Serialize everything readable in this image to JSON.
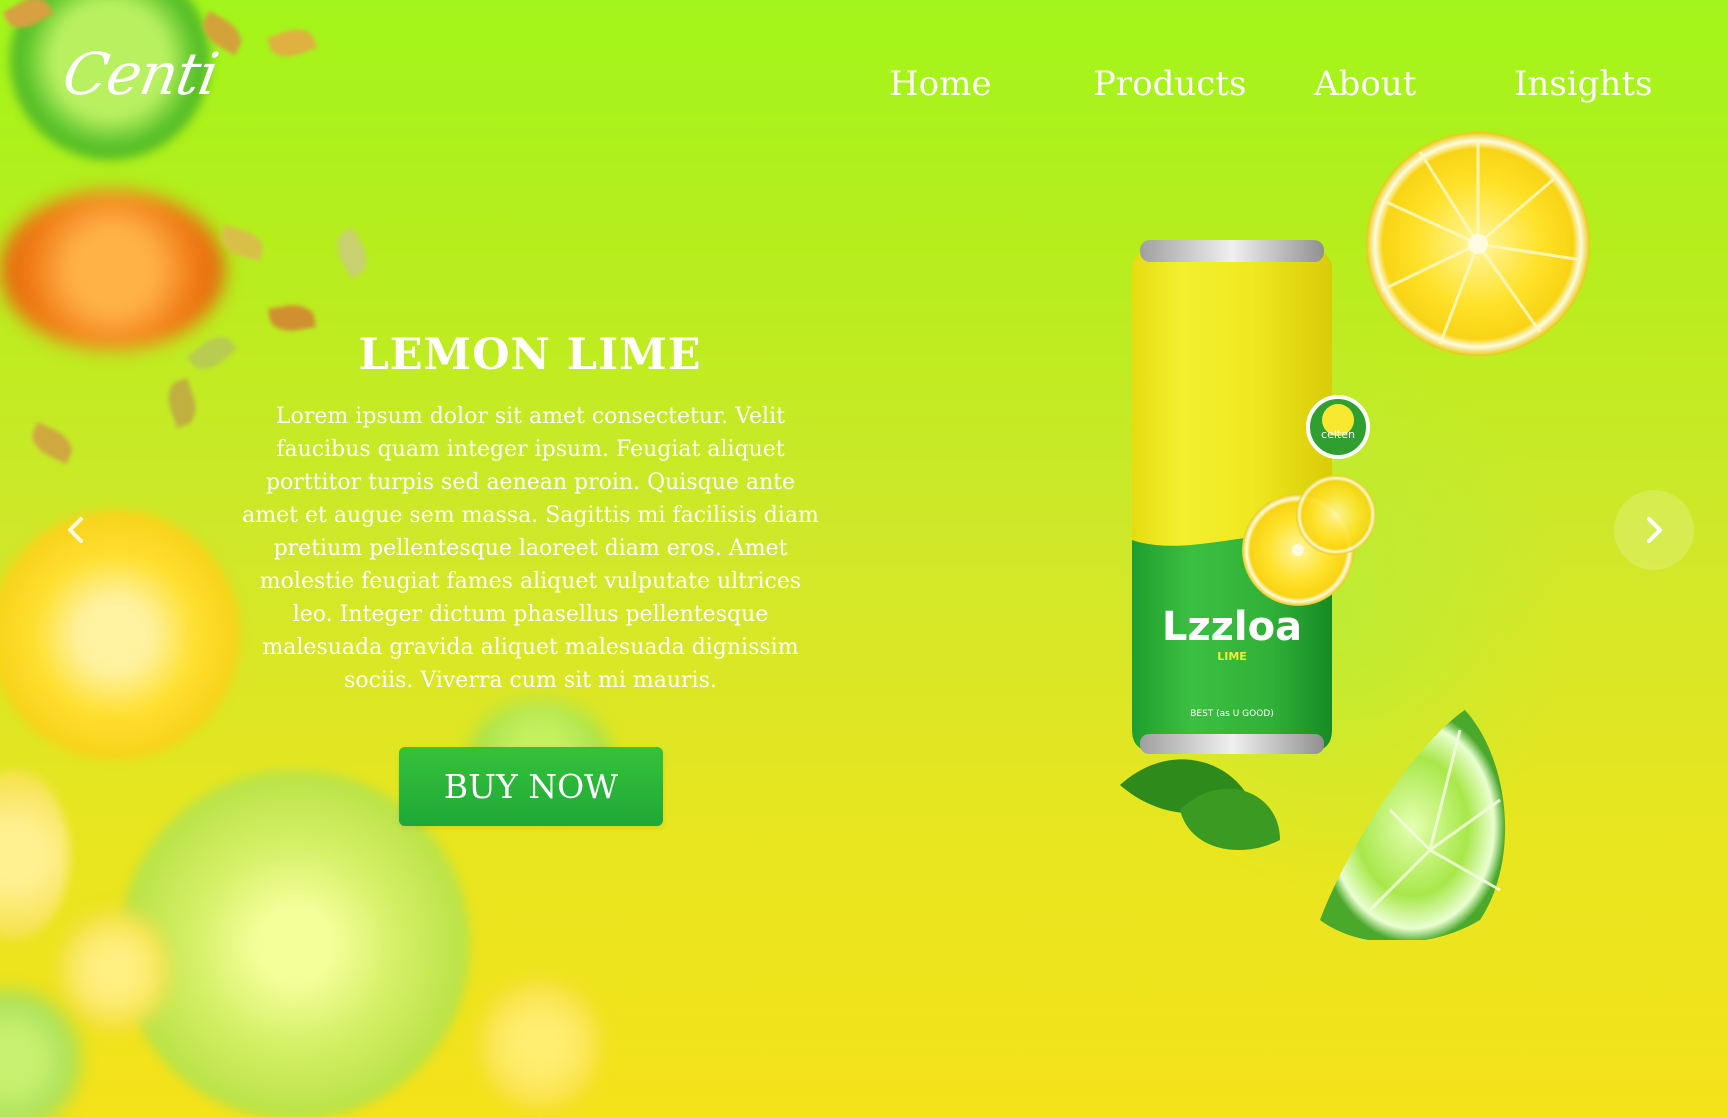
{
  "brand": {
    "logo_text": "Centi"
  },
  "nav": {
    "items": [
      {
        "label": "Home"
      },
      {
        "label": "Products"
      },
      {
        "label": "About"
      },
      {
        "label": "Insights"
      }
    ]
  },
  "hero": {
    "title": "LEMON LIME",
    "body": "Lorem ipsum dolor sit amet consectetur. Velit faucibus quam integer ipsum. Feugiat aliquet porttitor turpis sed aenean proin. Quisque ante amet et augue sem massa. Sagittis mi facilisis diam pretium pellentesque laoreet diam eros. Amet molestie feugiat fames aliquet vulputate ultrices leo. Integer dictum phasellus pellentesque malesuada gravida aliquet malesuada dignissim sociis. Viverra cum sit mi mauris.",
    "cta_label": "BUY NOW"
  },
  "carousel": {
    "prev_icon": "chevron-left-icon",
    "next_icon": "chevron-right-icon"
  },
  "product": {
    "can_brand": "Lzzloa",
    "can_flavor": "LIME",
    "badge_text": "celten",
    "small_line": "BEST (as U GOOD)"
  },
  "colors": {
    "bg_top": "#a2f51a",
    "bg_bottom": "#f4e21a",
    "cta": "#25b038",
    "text": "#ffffff"
  }
}
